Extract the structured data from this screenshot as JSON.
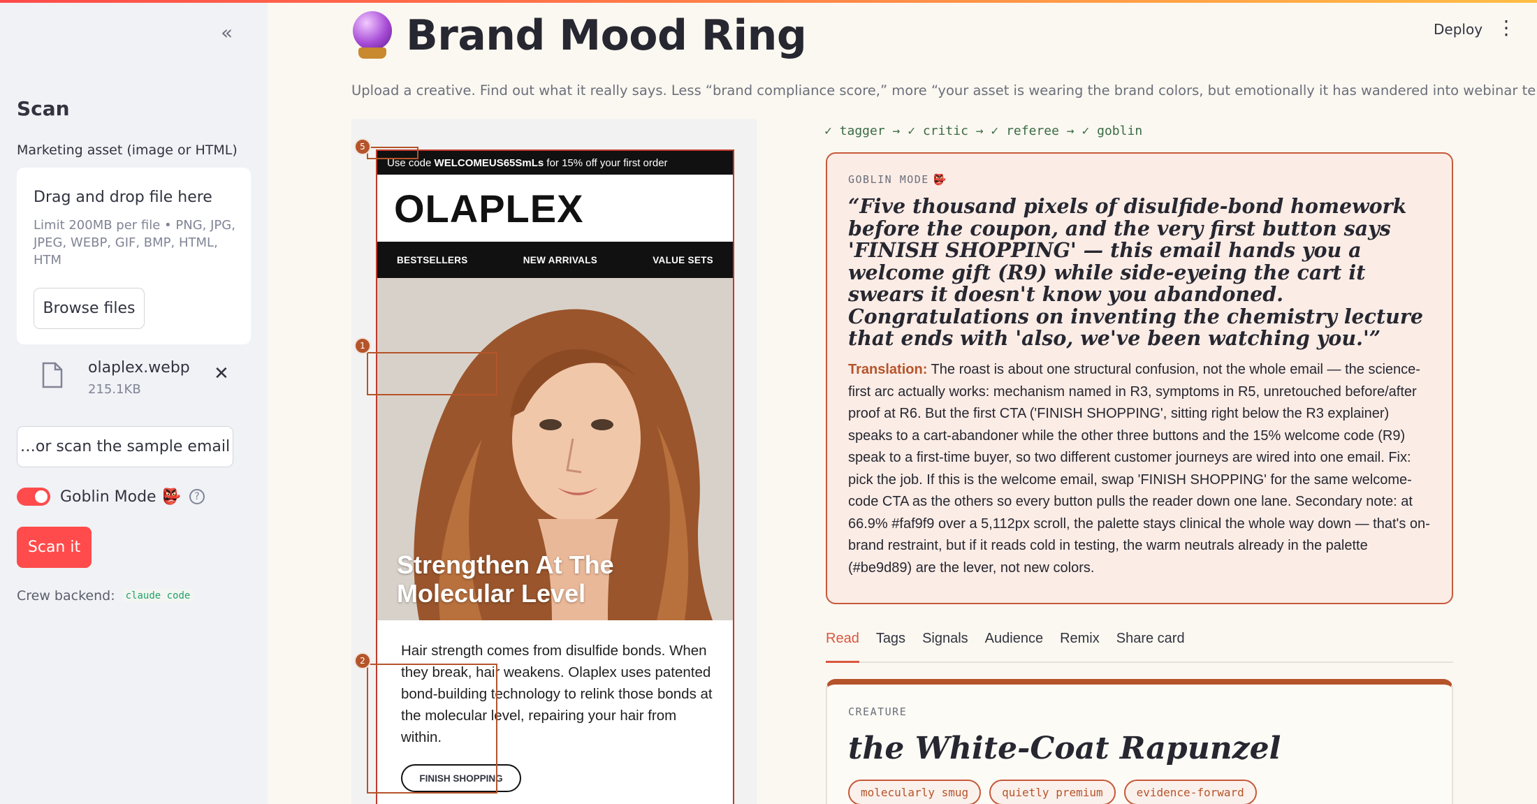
{
  "sidebar": {
    "title": "Scan",
    "upload_label": "Marketing asset (image or HTML)",
    "dropzone_title": "Drag and drop file here",
    "dropzone_limit": "Limit 200MB per file • PNG, JPG, JPEG, WEBP, GIF, BMP, HTML, HTM",
    "browse_label": "Browse files",
    "file_name": "olaplex.webp",
    "file_size": "215.1KB",
    "sample_label": "…or scan the sample email",
    "toggle_label": "Goblin Mode",
    "toggle_on": true,
    "help_glyph": "?",
    "scan_label": "Scan it",
    "backend_label": "Crew backend:",
    "backend_value": "claude code"
  },
  "header": {
    "deploy_label": "Deploy",
    "kebab_glyph": "⋮",
    "collapse_glyph": "«"
  },
  "main": {
    "title": "Brand Mood Ring",
    "subtitle": "Upload a creative. Find out what it really says. Less “brand compliance score,” more “your asset is wearing the brand colors, but emotionally it has wandered into webinar territory.”"
  },
  "email": {
    "promo_prefix": "Use code ",
    "promo_code": "WELCOMEUS65SmLs",
    "promo_suffix": " for 15% off your first order",
    "logo": "OLAPLEX",
    "nav": [
      "BESTSELLERS",
      "NEW ARRIVALS",
      "VALUE SETS"
    ],
    "hero_line1": "Strengthen At The",
    "hero_line2": "Molecular Level",
    "body": "Hair strength comes from disulfide bonds. When they break, hair weakens. Olaplex uses patented bond-building technology to relink those bonds at the molecular level, repairing your hair from within.",
    "cta": "FINISH SHOPPING",
    "markers": [
      "5",
      "1",
      "2"
    ]
  },
  "pipeline": "✓ tagger → ✓ critic → ✓ referee → ✓ goblin",
  "goblin": {
    "label": "GOBLIN MODE",
    "quote": "“Five thousand pixels of disulfide-bond homework before the coupon, and the very first button says 'FINISH SHOPPING' — this email hands you a welcome gift (R9) while side-eyeing the cart it swears it doesn't know you abandoned. Congratulations on inventing the chemistry lecture that ends with 'also, we've been watching you.'”",
    "translation_label": "Translation:",
    "translation": " The roast is about one structural confusion, not the whole email — the science-first arc actually works: mechanism named in R3, symptoms in R5, unretouched before/after proof at R6. But the first CTA ('FINISH SHOPPING', sitting right below the R3 explainer) speaks to a cart-abandoner while the other three buttons and the 15% welcome code (R9) speak to a first-time buyer, so two different customer journeys are wired into one email. Fix: pick the job. If this is the welcome email, swap 'FINISH SHOPPING' for the same welcome-code CTA as the others so every button pulls the reader down one lane. Secondary note: at 66.9% #faf9f9 over a 5,112px scroll, the palette stays clinical the whole way down — that's on-brand restraint, but if it reads cold in testing, the warm neutrals already in the palette (#be9d89) are the lever, not new colors."
  },
  "tabs": [
    "Read",
    "Tags",
    "Signals",
    "Audience",
    "Remix",
    "Share card"
  ],
  "active_tab": "Read",
  "creature": {
    "label": "CREATURE",
    "name": "the White-Coat Rapunzel",
    "chips": [
      "molecularly smug",
      "quietly premium",
      "evidence-forward"
    ]
  },
  "colors": {
    "accent": "#ff4b4b",
    "goblin_border": "#c65a3a",
    "goblin_bg": "#fbece6",
    "highlight": "#b5542a"
  }
}
